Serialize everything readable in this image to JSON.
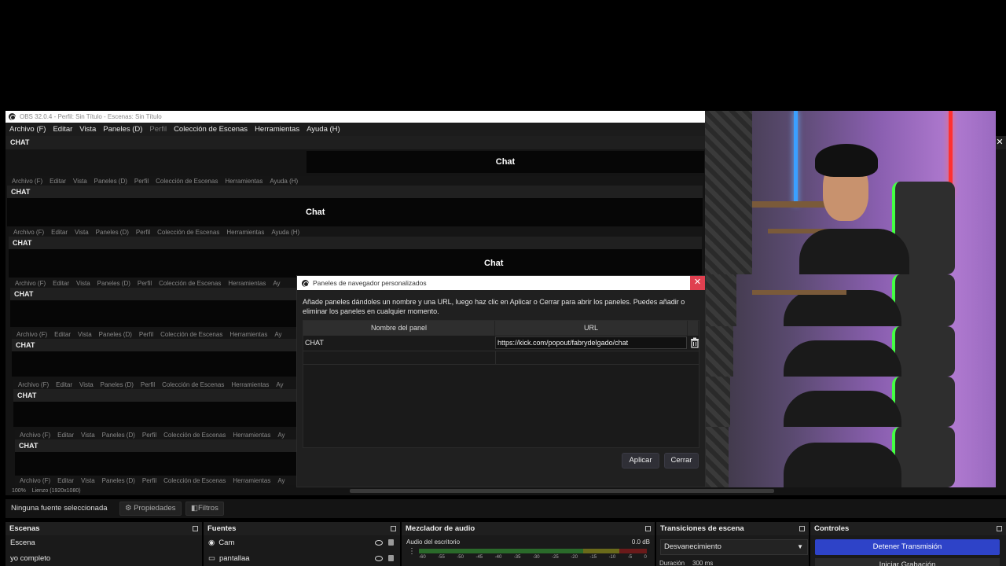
{
  "window": {
    "title": "OBS 32.0.4 - Perfil: Sin Título - Escenas: Sin Título"
  },
  "menu": [
    "Archivo (F)",
    "Editar",
    "Vista",
    "Paneles (D)",
    "Perfil",
    "Colección de Escenas",
    "Herramientas",
    "Ayuda (H)"
  ],
  "echo_menu": [
    "Archivo (F)",
    "Editar",
    "Vista",
    "Paneles (D)",
    "Perfil",
    "Colección de Escenas",
    "Herramientas",
    "Ayuda (H)"
  ],
  "echo_menu_short": [
    "Archivo (F)",
    "Editar",
    "Vista",
    "Paneles (D)",
    "Perfil",
    "Colección de Escenas",
    "Herramientas",
    "Ay"
  ],
  "chat_dock": {
    "header": "CHAT",
    "banner": "Chat"
  },
  "dialog": {
    "title": "Paneles de navegador personalizados",
    "description": "Añade paneles dándoles un nombre y una URL, luego haz clic en Aplicar o Cerrar para abrir los paneles. Puedes añadir o eliminar los paneles en cualquier momento.",
    "col_name": "Nombre del panel",
    "col_url": "URL",
    "row_name": "CHAT",
    "row_url": "https://kick.com/popout/fabrydelgado/chat",
    "apply": "Aplicar",
    "close": "Cerrar"
  },
  "status": {
    "zoom": "100%",
    "canvas": "Lienzo (1920x1080)"
  },
  "toolbar": {
    "no_source": "Ninguna fuente seleccionada",
    "properties": "Propiedades",
    "filters": "Filtros"
  },
  "scenes": {
    "title": "Escenas",
    "items": [
      "Escena",
      "yo completo"
    ]
  },
  "sources": {
    "title": "Fuentes",
    "items": [
      "Cam",
      "pantallaa"
    ]
  },
  "mixer": {
    "title": "Mezclador de audio",
    "track": "Audio del escritorio",
    "db": "0.0 dB",
    "ticks": [
      "-60",
      "-55",
      "-50",
      "-45",
      "-40",
      "-35",
      "-30",
      "-25",
      "-20",
      "-15",
      "-10",
      "-5",
      "0"
    ]
  },
  "transitions": {
    "title": "Transiciones de escena",
    "selected": "Desvanecimiento",
    "duration_label": "Duración",
    "duration_value": "300 ms"
  },
  "controls": {
    "title": "Controles",
    "stream": "Detener Transmisión",
    "record": "Iniciar Grabación"
  }
}
